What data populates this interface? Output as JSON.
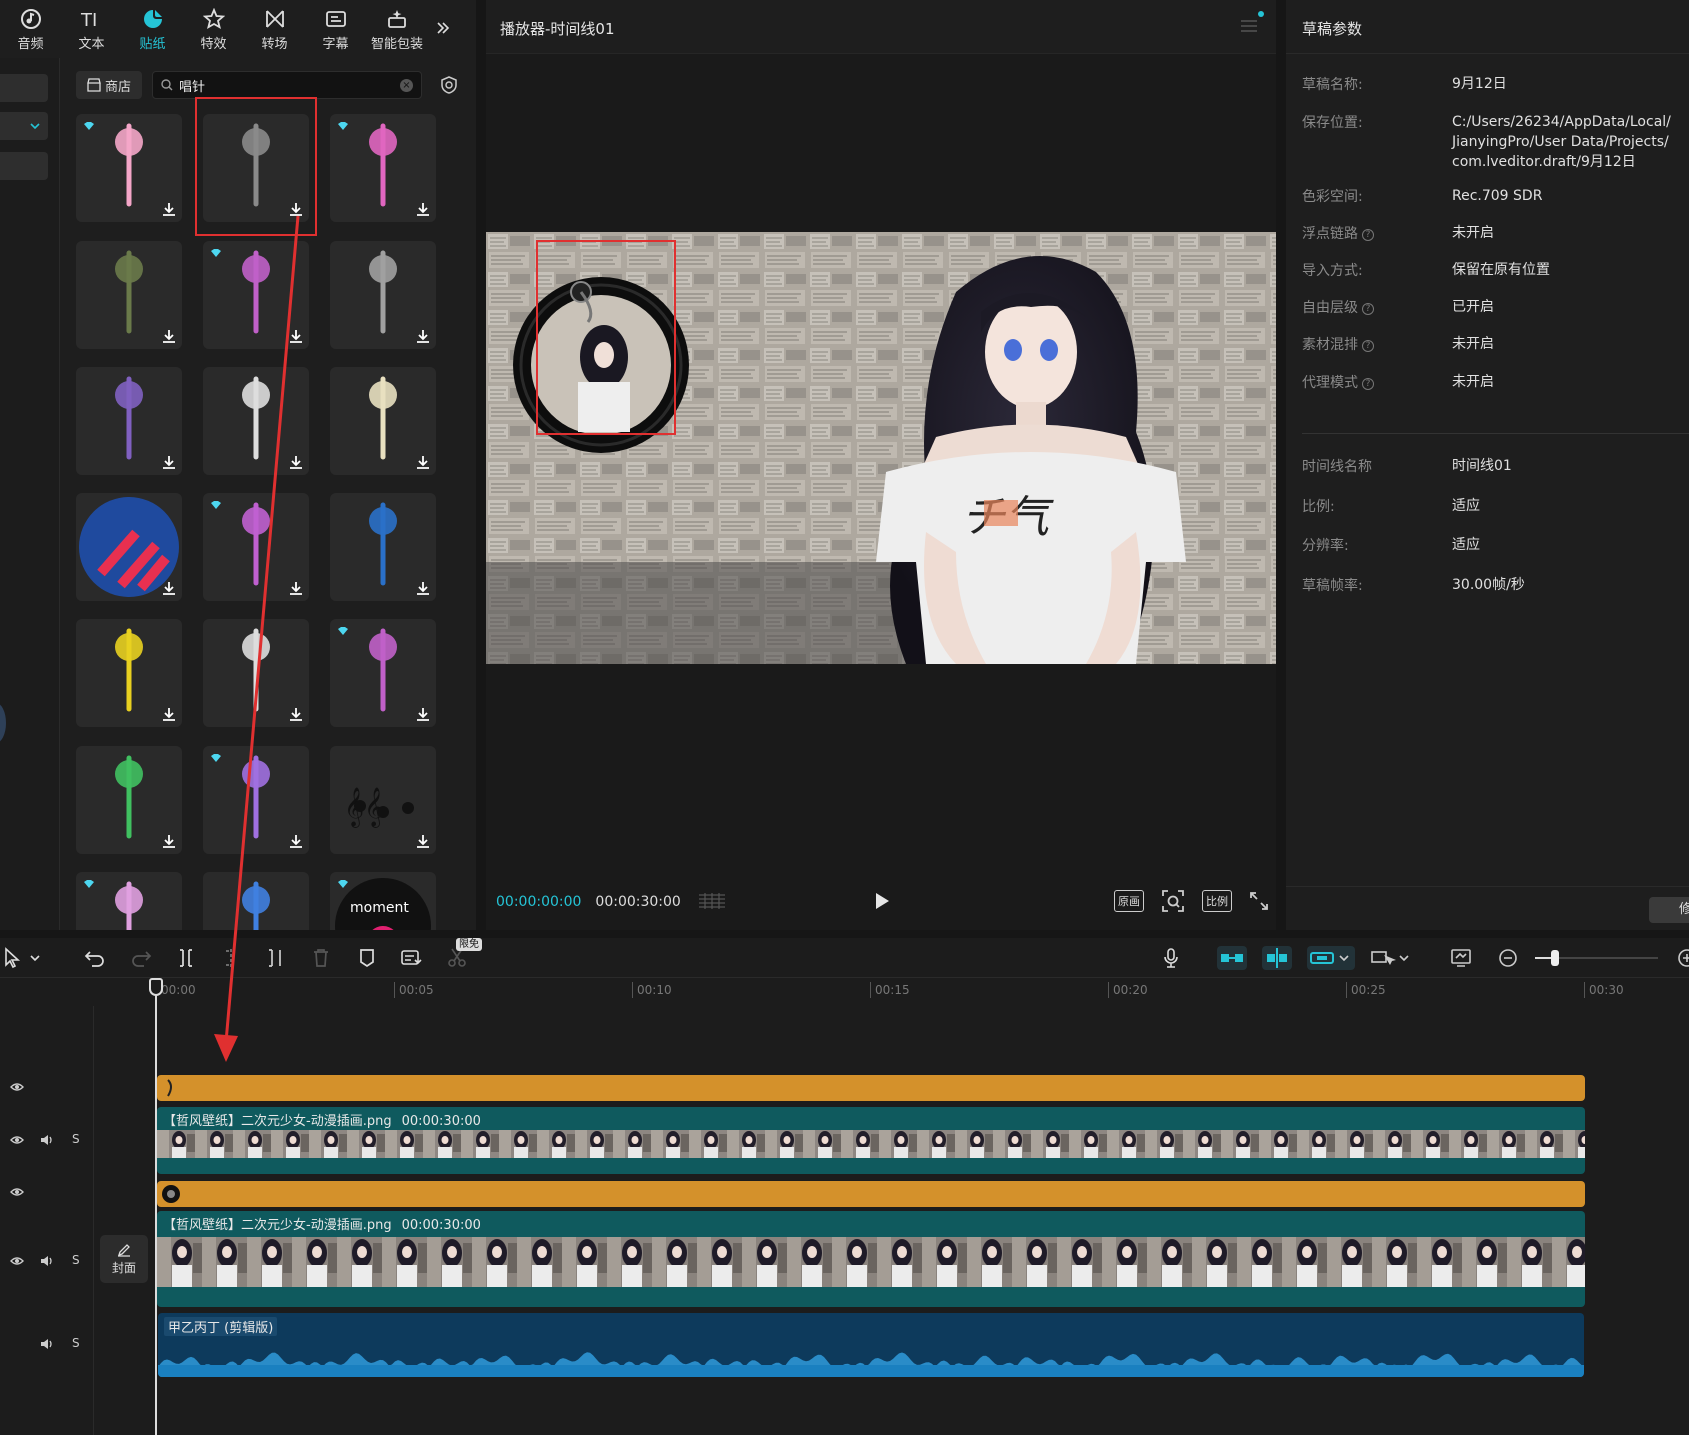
{
  "toolbar": {
    "tabs": [
      {
        "label": "音频",
        "icon": "audio-icon"
      },
      {
        "label": "文本",
        "icon": "text-icon"
      },
      {
        "label": "贴纸",
        "icon": "sticker-icon",
        "active": true
      },
      {
        "label": "特效",
        "icon": "effects-icon"
      },
      {
        "label": "转场",
        "icon": "transition-icon"
      },
      {
        "label": "字幕",
        "icon": "subtitle-icon"
      },
      {
        "label": "智能包装",
        "icon": "smart-package-icon"
      }
    ],
    "more_icon": "double-chevron-right-icon"
  },
  "sticker_panel": {
    "store_label": "商店",
    "search_value": "唱针",
    "stickers": [
      {
        "name": "pink-microphone-sticker",
        "premium": true
      },
      {
        "name": "tonearm-needle-sticker",
        "premium": false,
        "selected": true
      },
      {
        "name": "neon-microphone-sticker",
        "premium": true
      },
      {
        "name": "needle-green-cable-sticker",
        "premium": false
      },
      {
        "name": "purple-microphone-cable-sticker",
        "premium": true
      },
      {
        "name": "gray-tonearm-sticker",
        "premium": false
      },
      {
        "name": "purple-headphones-sticker",
        "premium": false
      },
      {
        "name": "vertical-needle-sticker",
        "premium": false
      },
      {
        "name": "retro-microphone-sticker",
        "premium": false
      },
      {
        "name": "syringes-circle-sticker",
        "premium": false
      },
      {
        "name": "boombox-sticker",
        "premium": true
      },
      {
        "name": "blue-pen-sticker",
        "premium": false
      },
      {
        "name": "yellow-microphone-sticker",
        "premium": false
      },
      {
        "name": "vertical-needle-2-sticker",
        "premium": false
      },
      {
        "name": "maracas-sticker",
        "premium": true
      },
      {
        "name": "green-syringe-sticker",
        "premium": false
      },
      {
        "name": "pink-music-mic-sticker",
        "premium": true
      },
      {
        "name": "music-notes-sticker",
        "premium": false
      },
      {
        "name": "ribbon-bottle-sticker",
        "premium": true
      },
      {
        "name": "blue-vial-sticker",
        "premium": false
      },
      {
        "name": "moment-record-sticker",
        "premium": true
      }
    ]
  },
  "player": {
    "title": "播放器-时间线01",
    "current_time": "00:00:00:00",
    "total_time": "00:00:30:00",
    "buttons": {
      "original": "原画",
      "ratio": "比例"
    }
  },
  "params": {
    "title": "草稿参数",
    "rows": [
      {
        "key": "草稿名称:",
        "value": "9月12日"
      },
      {
        "key": "保存位置:",
        "value": "C:/Users/26234/AppData/Local/\nJianyingPro/User Data/Projects/\ncom.lveditor.draft/9月12日"
      },
      {
        "key": "色彩空间:",
        "value": "Rec.709 SDR"
      },
      {
        "key": "浮点链路",
        "value": "未开启",
        "help": true
      },
      {
        "key": "导入方式:",
        "value": "保留在原有位置"
      },
      {
        "key": "自由层级",
        "value": "已开启",
        "help": true
      },
      {
        "key": "素材混排",
        "value": "未开启",
        "help": true
      },
      {
        "key": "代理模式",
        "value": "未开启",
        "help": true
      }
    ],
    "rows2": [
      {
        "key": "时间线名称",
        "value": "时间线01"
      },
      {
        "key": "比例:",
        "value": "适应"
      },
      {
        "key": "分辨率:",
        "value": "适应"
      },
      {
        "key": "草稿帧率:",
        "value": "30.00帧/秒"
      }
    ],
    "modify_label": "修"
  },
  "timeline": {
    "free_badge": "限免",
    "ruler": [
      "00:00",
      "00:05",
      "00:10",
      "00:15",
      "00:20",
      "00:25",
      "00:30"
    ],
    "cover_label": "封面",
    "solo_label": "S",
    "clips": {
      "video_top": {
        "name": "【哲风壁纸】二次元少女-动漫插画.png",
        "duration": "00:00:30:00"
      },
      "video_main": {
        "name": "【哲风壁纸】二次元少女-动漫插画.png",
        "duration": "00:00:30:00"
      },
      "audio": {
        "name": "甲乙丙丁 (剪辑版)"
      }
    },
    "colors": {
      "sticker": "#d4912b",
      "video": "#0f5a5e",
      "audio": "#1a6fa0",
      "accent": "#25c4d6",
      "annotation": "#e03030"
    }
  }
}
